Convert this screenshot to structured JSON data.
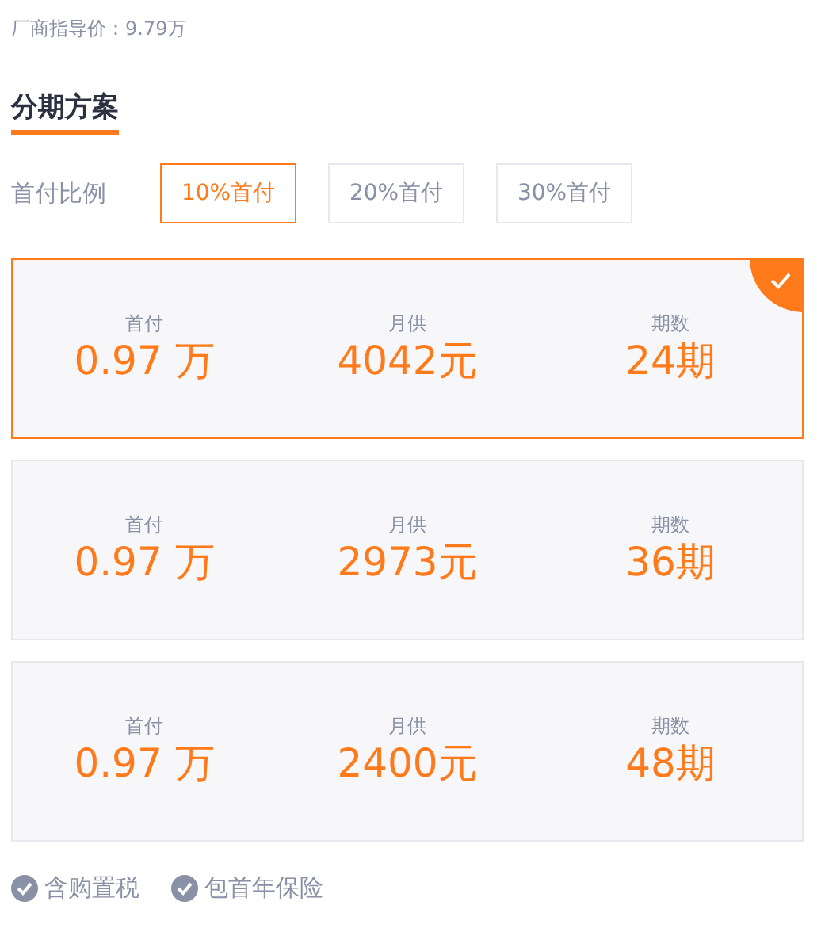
{
  "price": "厂商指导价：9.79万",
  "section_title": "分期方案",
  "ratio": {
    "label": "首付比例",
    "options": [
      {
        "label": "10%首付",
        "selected": true
      },
      {
        "label": "20%首付",
        "selected": false
      },
      {
        "label": "30%首付",
        "selected": false
      }
    ]
  },
  "plans": [
    {
      "selected": true,
      "fields": [
        {
          "label": "首付",
          "value": "0.97 万"
        },
        {
          "label": "月供",
          "value": "4042元"
        },
        {
          "label": "期数",
          "value": "24期"
        }
      ]
    },
    {
      "selected": false,
      "fields": [
        {
          "label": "首付",
          "value": "0.97 万"
        },
        {
          "label": "月供",
          "value": "2973元"
        },
        {
          "label": "期数",
          "value": "36期"
        }
      ]
    },
    {
      "selected": false,
      "fields": [
        {
          "label": "首付",
          "value": "0.97 万"
        },
        {
          "label": "月供",
          "value": "2400元"
        },
        {
          "label": "期数",
          "value": "48期"
        }
      ]
    }
  ],
  "notes": [
    "含购置税",
    "包首年保险"
  ]
}
